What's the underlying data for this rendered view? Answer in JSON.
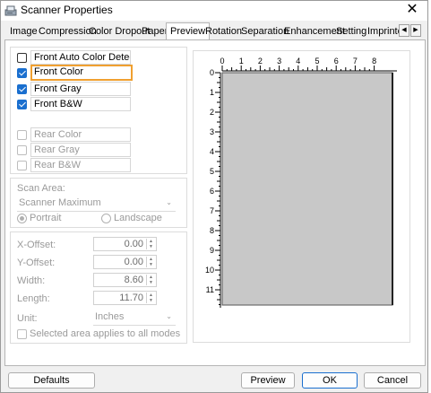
{
  "window": {
    "title": "Scanner Properties",
    "close_label": "✕"
  },
  "tabs": [
    {
      "label": "Image"
    },
    {
      "label": "Compression"
    },
    {
      "label": "Color Dropout"
    },
    {
      "label": "Paper"
    },
    {
      "label": "Preview"
    },
    {
      "label": "Rotation"
    },
    {
      "label": "Separation"
    },
    {
      "label": "Enhancement"
    },
    {
      "label": "Setting"
    },
    {
      "label": "Imprinter"
    }
  ],
  "tab_scroll": {
    "left": "◀",
    "right": "▶"
  },
  "image_modes": {
    "front": [
      {
        "label": "Front Auto Color Detection",
        "checked": false
      },
      {
        "label": "Front Color",
        "checked": true
      },
      {
        "label": "Front Gray",
        "checked": true
      },
      {
        "label": "Front B&W",
        "checked": true
      }
    ],
    "rear": [
      {
        "label": "Rear Color",
        "checked": false
      },
      {
        "label": "Rear Gray",
        "checked": false
      },
      {
        "label": "Rear B&W",
        "checked": false
      }
    ]
  },
  "scan_area": {
    "label": "Scan Area:",
    "value": "Scanner Maximum",
    "portrait_label": "Portrait",
    "landscape_label": "Landscape"
  },
  "offsets": {
    "x_label": "X-Offset:",
    "x_value": "0.00",
    "y_label": "Y-Offset:",
    "y_value": "0.00",
    "width_label": "Width:",
    "width_value": "8.60",
    "length_label": "Length:",
    "length_value": "11.70",
    "unit_label": "Unit:",
    "unit_value": "Inches",
    "apply_all_label": "Selected area applies to all modes"
  },
  "preview": {
    "h_ticks": [
      "0",
      "1",
      "2",
      "3",
      "4",
      "5",
      "6",
      "7",
      "8"
    ],
    "v_ticks": [
      "0",
      "1",
      "2",
      "3",
      "4",
      "5",
      "6",
      "7",
      "8",
      "9",
      "10",
      "11"
    ],
    "page_color": "#c8c8c8"
  },
  "buttons": {
    "defaults": "Defaults",
    "preview": "Preview",
    "ok": "OK",
    "cancel": "Cancel"
  },
  "colors": {
    "accent": "#1a6fcf",
    "focus": "#f0a030"
  }
}
